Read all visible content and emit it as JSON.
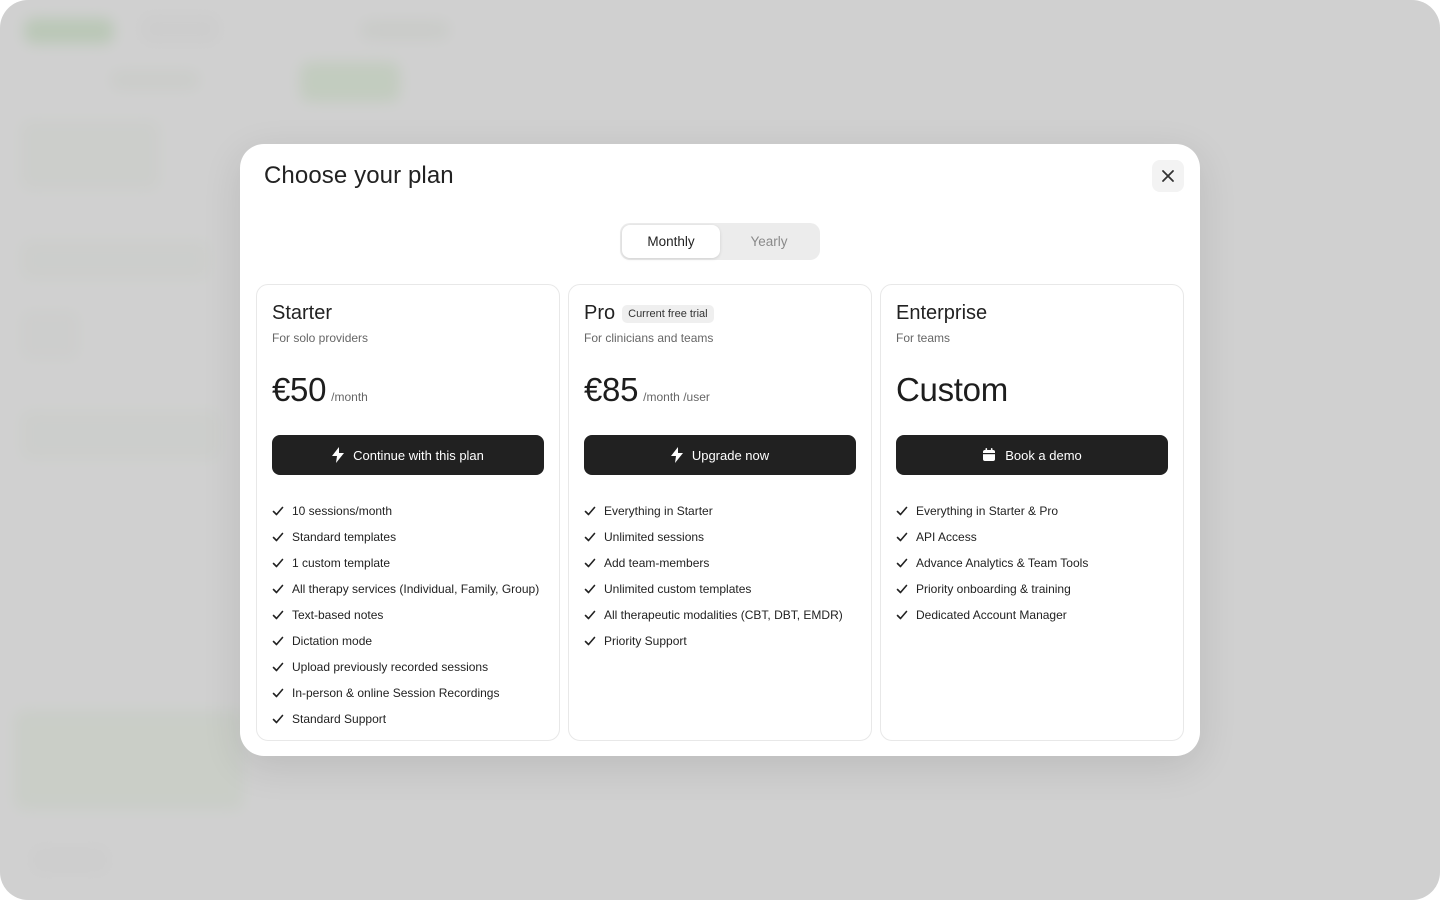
{
  "modal": {
    "title": "Choose your plan",
    "close_icon": "close-icon"
  },
  "billing_toggle": {
    "options": [
      "Monthly",
      "Yearly"
    ],
    "selected": "Monthly"
  },
  "plans": [
    {
      "name": "Starter",
      "badge": "",
      "subtitle": "For solo providers",
      "price": "€50",
      "period": "/month",
      "cta_label": "Continue with this plan",
      "cta_icon": "lightning-icon",
      "features": [
        "10 sessions/month",
        "Standard templates",
        "1 custom template",
        "All therapy services (Individual, Family, Group)",
        "Text-based notes",
        "Dictation mode",
        "Upload previously recorded sessions",
        "In-person & online Session Recordings",
        "Standard Support"
      ]
    },
    {
      "name": "Pro",
      "badge": "Current free trial",
      "subtitle": "For clinicians and teams",
      "price": "€85",
      "period": "/month /user",
      "cta_label": "Upgrade now",
      "cta_icon": "lightning-icon",
      "features": [
        "Everything in Starter",
        "Unlimited sessions",
        "Add team-members",
        "Unlimited custom templates",
        "All therapeutic modalities (CBT, DBT, EMDR)",
        "Priority Support"
      ]
    },
    {
      "name": "Enterprise",
      "badge": "",
      "subtitle": "For teams",
      "price": "Custom",
      "period": "",
      "cta_label": "Book a demo",
      "cta_icon": "calendar-icon",
      "features": [
        "Everything in Starter & Pro",
        "API Access",
        "Advance Analytics & Team Tools",
        "Priority onboarding & training",
        "Dedicated Account Manager"
      ]
    }
  ],
  "colors": {
    "cta_background": "#212121",
    "overlay": "#c8c8c8",
    "background_accent": "#8fcf7a"
  }
}
